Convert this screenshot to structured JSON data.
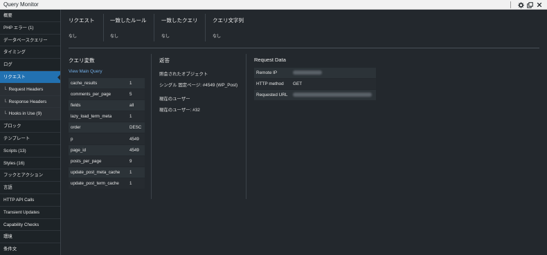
{
  "window": {
    "title": "Query Monitor",
    "controls": [
      "gear-icon",
      "popout-icon",
      "close-icon"
    ]
  },
  "sidebar": {
    "items": [
      {
        "label": "概要",
        "sub": false,
        "active": false
      },
      {
        "label": "PHP エラー (1)",
        "sub": false,
        "active": false
      },
      {
        "label": "データベースクエリー",
        "sub": false,
        "active": false
      },
      {
        "label": "タイミング",
        "sub": false,
        "active": false
      },
      {
        "label": "ログ",
        "sub": false,
        "active": false
      },
      {
        "label": "リクエスト",
        "sub": false,
        "active": true
      },
      {
        "label": "Request Headers",
        "sub": true,
        "active": false
      },
      {
        "label": "Response Headers",
        "sub": true,
        "active": false
      },
      {
        "label": "Hooks in Use (9)",
        "sub": true,
        "active": false
      },
      {
        "label": "ブロック",
        "sub": false,
        "active": false
      },
      {
        "label": "テンプレート",
        "sub": false,
        "active": false
      },
      {
        "label": "Scripts (13)",
        "sub": false,
        "active": false
      },
      {
        "label": "Styles (16)",
        "sub": false,
        "active": false
      },
      {
        "label": "フックとアクション",
        "sub": false,
        "active": false
      },
      {
        "label": "言語",
        "sub": false,
        "active": false
      },
      {
        "label": "HTTP API Calls",
        "sub": false,
        "active": false
      },
      {
        "label": "Transient Updates",
        "sub": false,
        "active": false
      },
      {
        "label": "Capability Checks",
        "sub": false,
        "active": false
      },
      {
        "label": "環境",
        "sub": false,
        "active": false
      },
      {
        "label": "条件文",
        "sub": false,
        "active": false
      }
    ]
  },
  "top": {
    "columns": [
      {
        "heading": "リクエスト",
        "value": "なし"
      },
      {
        "heading": "一致したルール",
        "value": "なし"
      },
      {
        "heading": "一致したクエリ",
        "value": "なし"
      },
      {
        "heading": "クエリ文字列",
        "value": "なし"
      }
    ]
  },
  "query_vars": {
    "title": "クエリ変数",
    "link": "View Main Query",
    "rows": [
      {
        "key": "cache_results",
        "value": "1"
      },
      {
        "key": "comments_per_page",
        "value": "5"
      },
      {
        "key": "fields",
        "value": "all"
      },
      {
        "key": "lazy_load_term_meta",
        "value": "1"
      },
      {
        "key": "order",
        "value": "DESC"
      },
      {
        "key": "p",
        "value": "4549"
      },
      {
        "key": "page_id",
        "value": "4549"
      },
      {
        "key": "posts_per_page",
        "value": "9"
      },
      {
        "key": "update_post_meta_cache",
        "value": "1"
      },
      {
        "key": "update_post_term_cache",
        "value": "1"
      }
    ]
  },
  "response": {
    "title": "返答",
    "queried_object_label": "照会されたオブジェクト",
    "queried_object_value": "シングル 固定ページ: #4549 (WP_Post)",
    "current_user_label": "現在のユーザー",
    "current_user_value": "現在のユーザー: #32"
  },
  "request_data": {
    "title": "Request Data",
    "rows": [
      {
        "key": "Remote IP",
        "value": "",
        "redacted": true
      },
      {
        "key": "HTTP method",
        "value": "GET",
        "redacted": false
      },
      {
        "key": "Requested URL",
        "value": "",
        "redacted": true
      }
    ]
  }
}
